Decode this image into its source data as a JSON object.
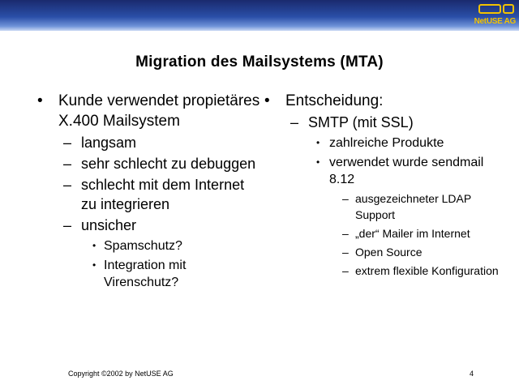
{
  "brand": {
    "logo_text": "NetUSE AG",
    "colors": {
      "header_dark": "#1a2a6e",
      "header_light": "#c9d8f4",
      "logo": "#f2c200"
    }
  },
  "slide": {
    "title": "Migration des Mailsystems (MTA)",
    "left": {
      "bullet": "Kunde verwendet propietäres X.400 Mailsystem",
      "subitems": [
        "langsam",
        "sehr schlecht zu debuggen",
        "schlecht mit dem Internet zu integrieren",
        "unsicher"
      ],
      "unsicher_items": [
        "Spamschutz?",
        "Integration mit Virenschutz?"
      ]
    },
    "right": {
      "bullet": "Entscheidung:",
      "sub": "SMTP (mit SSL)",
      "subsub": [
        "zahlreiche Produkte",
        "verwendet wurde sendmail 8.12"
      ],
      "sendmail_items": [
        "ausgezeichneter LDAP Support",
        "„der“ Mailer im Internet",
        "Open Source",
        "extrem flexible Konfiguration"
      ]
    },
    "markers": {
      "bullet": "•",
      "dash": "–"
    }
  },
  "footer": {
    "copyright": "Copyright ©2002 by NetUSE AG",
    "page_number": "4"
  }
}
